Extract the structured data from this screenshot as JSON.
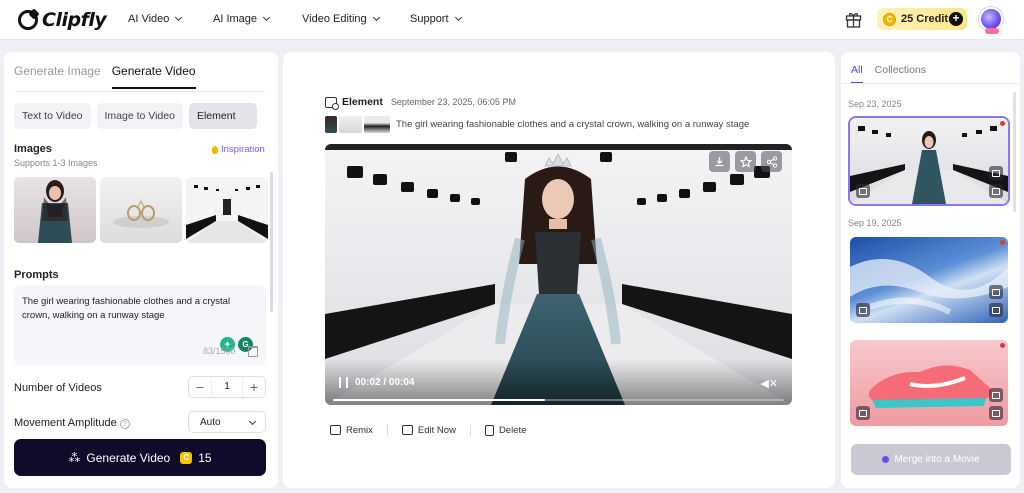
{
  "header": {
    "logo": "Clipfly",
    "nav": [
      {
        "label": "AI Video"
      },
      {
        "label": "AI Image"
      },
      {
        "label": "Video Editing"
      },
      {
        "label": "Support"
      }
    ],
    "credits": "25 Credits",
    "icons": {
      "gift": "gift-icon",
      "plus": "plus-icon"
    }
  },
  "left": {
    "tabs": [
      "Generate Image",
      "Generate Video"
    ],
    "active_tab": "Generate Video",
    "modes": [
      "Text to Video",
      "Image to Video",
      "Element"
    ],
    "active_mode": "Element",
    "images_title": "Images",
    "images_sub": "Supports 1-3 Images",
    "inspiration": "Inspiration",
    "prompts_title": "Prompts",
    "prompt_text": "The girl wearing fashionable clothes and a crystal crown, walking on a runway stage",
    "counter": "83/1500",
    "num_videos_label": "Number of Videos",
    "num_videos_value": "1",
    "movement_label": "Movement Amplitude",
    "movement_value": "Auto",
    "generate_label": "Generate Video",
    "generate_cost": "15"
  },
  "center": {
    "title": "Element",
    "date": "September 23, 2025, 06:05 PM",
    "prompt": "The girl wearing fashionable clothes and a crystal crown, walking on a runway stage",
    "time": "00:02 / 00:04",
    "progress": 0.47,
    "actions": [
      "Remix",
      "Edit Now",
      "Delete"
    ]
  },
  "right": {
    "tabs": [
      "All",
      "Collections"
    ],
    "active_tab": "All",
    "groups": [
      {
        "date": "Sep 23, 2025"
      },
      {
        "date": "Sep 19, 2025"
      }
    ],
    "merge_label": "Merge into a Movie"
  },
  "colors": {
    "accent": "#5b3cf0",
    "button_dark": "#0f0b2a",
    "credits_bg": "#fde58a"
  }
}
